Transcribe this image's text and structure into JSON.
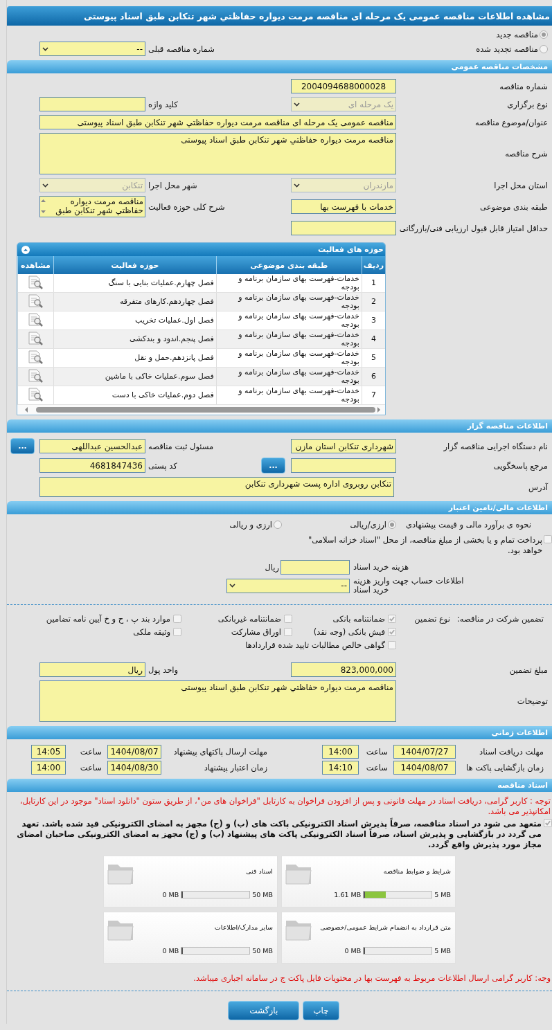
{
  "title": "مشاهده اطلاعات مناقصه عمومی یک مرحله ای مناقصه مرمت دیواره حفاظتي شهر تنکابن طبق اسناد پیوستی",
  "tender_kind": [
    {
      "label": "مناقصه جدید",
      "selected": true
    },
    {
      "label": "مناقصه تجدید شده",
      "selected": false
    }
  ],
  "previous_tender": {
    "label": "شماره مناقصه قبلی",
    "value": "--"
  },
  "general": {
    "heading": "مشخصات مناقصه عمومی",
    "rows": [
      {
        "fields": [
          {
            "label": "شماره مناقصه",
            "kind": "code",
            "value": "2004094688000028"
          }
        ]
      },
      {
        "fields": [
          {
            "label": "نوع برگزاری",
            "kind": "select",
            "value": "یک مرحله ای",
            "disabled": true
          },
          {
            "label": "کلید واژه",
            "kind": "text"
          }
        ]
      },
      {
        "fields": [
          {
            "label": "عنوان/موضوع مناقصه",
            "kind": "long-text",
            "value": "مناقصه عمومی یک مرحله ای مناقصه مرمت دیواره حفاظتي شهر تنکابن طبق اسناد پیوستی"
          }
        ]
      },
      {
        "fields": [
          {
            "label": "شرح مناقصه",
            "kind": "textarea",
            "value": "مناقصه مرمت دیواره حفاظتي شهر تنکابن طبق اسناد پیوستی"
          }
        ]
      },
      {
        "fields": [
          {
            "label": "استان محل اجرا",
            "kind": "select",
            "value": "مازندران",
            "disabled": true
          },
          {
            "label": "شهر محل اجرا",
            "kind": "select",
            "value": "تنکابن",
            "disabled": true
          }
        ]
      },
      {
        "fields": [
          {
            "label": "طبقه بندی موضوعی",
            "kind": "text",
            "value": "خدمات با فهرست بها"
          },
          {
            "label": "شرح کلی حوزه فعالیت",
            "kind": "list",
            "value": "مناقصه مرمت دیواره حفاظتي شهر تنکابن طبق"
          }
        ]
      },
      {
        "fields": [
          {
            "label": "حداقل امتیاز قابل قبول ارزیابی فنی/بازرگانی",
            "kind": "text"
          }
        ]
      }
    ]
  },
  "activities": {
    "heading": "حوزه های فعالیت",
    "columns": [
      "ردیف",
      "طبقه بندی موضوعی",
      "حوزه فعالیت",
      "مشاهده"
    ],
    "rows": [
      {
        "index": "1",
        "category": "خدمات-فهرست بهای سازمان برنامه و بودجه",
        "activity": "فصل چهارم.عملیات بنایی با سنگ"
      },
      {
        "index": "2",
        "category": "خدمات-فهرست بهای سازمان برنامه و بودجه",
        "activity": "فصل چهاردهم.کارهای متفرقه"
      },
      {
        "index": "3",
        "category": "خدمات-فهرست بهای سازمان برنامه و بودجه",
        "activity": "فصل اول.عملیات تخریب"
      },
      {
        "index": "4",
        "category": "خدمات-فهرست بهای سازمان برنامه و بودجه",
        "activity": "فصل پنجم.اندود و بندکشی"
      },
      {
        "index": "5",
        "category": "خدمات-فهرست بهای سازمان برنامه و بودجه",
        "activity": "فصل پانزدهم.حمل و نقل"
      },
      {
        "index": "6",
        "category": "خدمات-فهرست بهای سازمان برنامه و بودجه",
        "activity": "فصل سوم.عملیات خاکی با ماشین"
      },
      {
        "index": "7",
        "category": "خدمات-فهرست بهای سازمان برنامه و بودجه",
        "activity": "فصل دوم.عملیات خاکی با دست"
      }
    ]
  },
  "organizer": {
    "heading": "اطلاعات مناقصه گزار",
    "rows": [
      {
        "fields": [
          {
            "label": "نام دستگاه اجرایی مناقصه گزار",
            "kind": "text",
            "value": "شهرداری تنکابن استان مازن"
          },
          {
            "label": "مسئول ثبت مناقصه",
            "kind": "text",
            "value": "عبدالحسین عبداللهی",
            "button": "..."
          }
        ]
      },
      {
        "fields": [
          {
            "label": "مرجع پاسخگویی",
            "kind": "text",
            "button": "..."
          },
          {
            "label": "کد پستی",
            "kind": "text",
            "value": "4681847436"
          }
        ]
      },
      {
        "fields": [
          {
            "label": "آدرس",
            "kind": "address",
            "value": "تنکابن روبروی اداره پست شهرداری تنکابن"
          }
        ]
      }
    ]
  },
  "finance": {
    "heading": "اطلاعات مالی/تامین اعتبار",
    "estimate": {
      "label": "نحوه ی برآورد مالی و قیمت پیشنهادی",
      "options": [
        {
          "label": "ارزی/ریالی",
          "selected": true
        },
        {
          "label": "ارزی و ریالی",
          "selected": false
        }
      ]
    },
    "treasury": {
      "label": "پرداخت تمام و یا بخشی از مبلغ مناقصه، از محل \"اسناد خزانه اسلامی\" خواهد بود.",
      "checked": false
    },
    "doc_fee": {
      "label": "هزینه خرید اسناد",
      "unit": "ریال"
    },
    "account": {
      "label": "اطلاعات حساب جهت واریز هزینه خرید اسناد",
      "value": "--"
    }
  },
  "guarantee": {
    "label": "تضمین شرکت در مناقصه:",
    "type_label": "نوع تضمین",
    "options": [
      {
        "label": "ضمانتنامه بانکی",
        "checked": true
      },
      {
        "label": "ضمانتنامه غیربانکی",
        "checked": false
      },
      {
        "label": "موارد بند پ ، ح و خ آیین نامه تضامین",
        "checked": false
      },
      {
        "label": "فیش بانکی (وجه نقد)",
        "checked": true
      },
      {
        "label": "اوراق مشارکت",
        "checked": false
      },
      {
        "label": "وثیقه ملکی",
        "checked": false
      },
      {
        "label": "گواهی خالص مطالبات تایید شده قراردادها",
        "checked": false
      }
    ],
    "rows": [
      {
        "fields": [
          {
            "label": "مبلغ تضمین",
            "kind": "text",
            "value": "823,000,000"
          },
          {
            "label": "واحد پول",
            "kind": "text",
            "value": "ریال"
          }
        ]
      },
      {
        "fields": [
          {
            "label": "توضیحات",
            "kind": "textarea",
            "value": "مناقصه مرمت دیواره حفاظتي شهر تنکابن طبق اسناد پیوستی"
          }
        ]
      }
    ]
  },
  "timing": {
    "heading": "اطلاعات زمانی",
    "rows": [
      {
        "items": [
          {
            "label": "مهلت دریافت اسناد",
            "date": "1404/07/27",
            "time_label": "ساعت",
            "time": "14:00"
          },
          {
            "label": "مهلت ارسال پاکتهای پیشنهاد",
            "date": "1404/08/07",
            "time_label": "ساعت",
            "time": "14:05"
          }
        ]
      },
      {
        "items": [
          {
            "label": "زمان بازگشایی پاکت ها",
            "date": "1404/08/07",
            "time_label": "ساعت",
            "time": "14:10"
          },
          {
            "label": "زمان اعتبار پیشنهاد",
            "date": "1404/08/30",
            "time_label": "ساعت",
            "time": "14:00"
          }
        ]
      }
    ]
  },
  "documents": {
    "heading": "اسناد مناقصه",
    "notice": "توجه : کاربر گرامی، دریافت اسناد در مهلت قانونی و پس از افزودن فراخوان به کارتابل \"فراخوان های من\"، از طریق ستون \"دانلود اسناد\" موجود در این کارتابل، امکانپذیر می باشد.",
    "pledge": {
      "text": "متعهد می شود در اسناد مناقصه، صرفاً پذیرش اسناد الکترونیکی پاکت های (ب) و (ج) مجهز به امضای الکترونیکی قید شده باشد. تعهد می گردد در بازگشایی و پذیرش اسناد، صرفاً اسناد الکترونیکی پاکت های پیشنهاد (ب) و (ج) مجهز به امضای الکترونیکی صاحبان امضای مجاز مورد پذیرش واقع گردد.",
      "checked": true
    },
    "files": [
      {
        "name": "شرایط و ضوابط مناقصه",
        "used": "1.61 MB",
        "max": "5 MB",
        "level": 0.32
      },
      {
        "name": "اسناد فنی",
        "used": "0 MB",
        "max": "50 MB",
        "level": 0
      },
      {
        "name": "متن قرارداد به انضمام شرایط عمومی/خصوصی",
        "used": "0 MB",
        "max": "5 MB",
        "level": 0
      },
      {
        "name": "سایر مدارک/اطلاعات",
        "used": "0 MB",
        "max": "50 MB",
        "level": 0
      }
    ],
    "footnote": "وجه: کاربر گرامی ارسال اطلاعات مربوط به فهرست بها در محتویات فایل پاکت ج در سامانه اجباری میباشد."
  },
  "buttons": [
    "چاپ",
    "بازگشت"
  ]
}
